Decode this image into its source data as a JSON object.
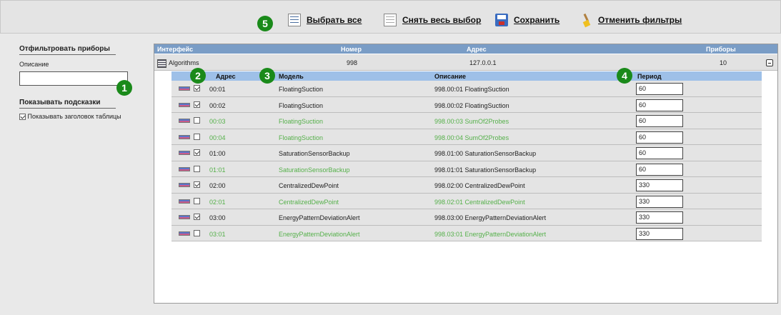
{
  "toolbar": {
    "badge": "5",
    "select_all": "Выбрать все",
    "deselect_all": "Снять весь выбор",
    "save": "Сохранить",
    "cancel_filters": "Отменить фильтры"
  },
  "sidebar": {
    "filter_title": "Отфильтровать приборы",
    "description_label": "Описание",
    "description_value": "",
    "hints_title": "Показывать подсказки",
    "show_header_label": "Показывать заголовок таблицы",
    "badge": "1"
  },
  "outer_table": {
    "headers": [
      "Интерфейс",
      "Номер",
      "Адрес",
      "Приборы"
    ],
    "row": {
      "interface": "Algorithms",
      "number": "998",
      "address": "127.0.0.1",
      "devices": "10"
    }
  },
  "inner_table": {
    "headers": {
      "address": "Адрес",
      "model": "Модель",
      "description": "Описание",
      "period": "Период"
    },
    "badges": {
      "address": "2",
      "model": "3",
      "period": "4"
    },
    "rows": [
      {
        "address": "00:01",
        "model": "FloatingSuction",
        "description": "998.00:01 FloatingSuction",
        "period": "60",
        "checked": true,
        "green": false
      },
      {
        "address": "00:02",
        "model": "FloatingSuction",
        "description": "998.00:02 FloatingSuction",
        "period": "60",
        "checked": true,
        "green": false
      },
      {
        "address": "00:03",
        "model": "FloatingSuction",
        "description": "998.00:03 SumOf2Probes",
        "period": "60",
        "checked": false,
        "green": true
      },
      {
        "address": "00:04",
        "model": "FloatingSuction",
        "description": "998.00:04 SumOf2Probes",
        "period": "60",
        "checked": false,
        "green": true
      },
      {
        "address": "01:00",
        "model": "SaturationSensorBackup",
        "description": "998.01:00 SaturationSensorBackup",
        "period": "60",
        "checked": true,
        "green": false
      },
      {
        "address": "01:01",
        "model": "SaturationSensorBackup",
        "description": "998.01:01 SaturationSensorBackup",
        "period": "60",
        "checked": false,
        "green": true,
        "desc_plain": true
      },
      {
        "address": "02:00",
        "model": "CentralizedDewPoint",
        "description": "998.02:00 CentralizedDewPoint",
        "period": "330",
        "checked": true,
        "green": false
      },
      {
        "address": "02:01",
        "model": "CentralizedDewPoint",
        "description": "998.02:01 CentralizedDewPoint",
        "period": "330",
        "checked": false,
        "green": true
      },
      {
        "address": "03:00",
        "model": "EnergyPatternDeviationAlert",
        "description": "998.03:00 EnergyPatternDeviationAlert",
        "period": "330",
        "checked": true,
        "green": false
      },
      {
        "address": "03:01",
        "model": "EnergyPatternDeviationAlert",
        "description": "998.03:01 EnergyPatternDeviationAlert",
        "period": "330",
        "checked": false,
        "green": true
      }
    ]
  },
  "colors": {
    "green_text": "#55b04a",
    "badge_green": "#1a8a1a",
    "header_blue": "#7a9dc6",
    "subheader_blue": "#9ec0e8"
  }
}
